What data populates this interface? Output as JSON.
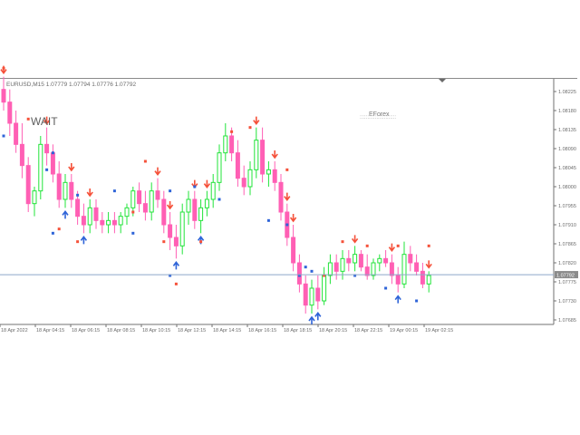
{
  "window": {
    "symbol_info": "EURUSD,M15  1.07779 1.07794 1.07776 1.07792"
  },
  "overlay": {
    "signal_text": "WAIT",
    "brand_text": "EForex",
    "brand_underline": "::::::::::::::::::::::::"
  },
  "colors": {
    "bull": "#22e43a",
    "bear": "#ff5fb4",
    "up_arrow": "#2f64d8",
    "down_arrow": "#f5513a",
    "current_price_line": "#8ea7c9",
    "price_tag_bg": "#8b8b8b",
    "axis": "#707070",
    "text": "#6b6b6b"
  },
  "chart_data": {
    "type": "candlestick",
    "timeframe": "M15",
    "symbol": "EURUSD",
    "ylim": [
      1.0766,
      1.0832
    ],
    "current_price": 1.07792,
    "current_price_label": "1.07792",
    "y_ticks": [
      "1.08225",
      "1.08180",
      "1.08135",
      "1.08090",
      "1.08045",
      "1.08000",
      "1.07955",
      "1.07910",
      "1.07865",
      "1.07820",
      "1.07775",
      "1.07730",
      "1.07685"
    ],
    "x_ticks": [
      "18 Apr 2022",
      "18 Apr 04:15",
      "18 Apr 06:15",
      "18 Apr 08:15",
      "18 Apr 10:15",
      "18 Apr 12:15",
      "18 Apr 14:15",
      "18 Apr 16:15",
      "18 Apr 18:15",
      "18 Apr 20:15",
      "18 Apr 22:15",
      "19 Apr 00:15",
      "19 Apr 02:15"
    ],
    "candles": [
      [
        1.0823,
        1.0826,
        1.0818,
        1.082
      ],
      [
        1.082,
        1.0823,
        1.0812,
        1.0815
      ],
      [
        1.0815,
        1.0818,
        1.0808,
        1.081
      ],
      [
        1.081,
        1.0815,
        1.0802,
        1.0805
      ],
      [
        1.0805,
        1.0807,
        1.0794,
        1.0796
      ],
      [
        1.0796,
        1.08,
        1.0793,
        1.0799
      ],
      [
        1.0799,
        1.0812,
        1.0797,
        1.081
      ],
      [
        1.081,
        1.0814,
        1.0805,
        1.0808
      ],
      [
        1.0808,
        1.081,
        1.0801,
        1.0803
      ],
      [
        1.0803,
        1.0806,
        1.0795,
        1.0797
      ],
      [
        1.0797,
        1.0803,
        1.0795,
        1.0801
      ],
      [
        1.0801,
        1.0803,
        1.0795,
        1.0797
      ],
      [
        1.0797,
        1.0799,
        1.0791,
        1.0793
      ],
      [
        1.0793,
        1.0796,
        1.0789,
        1.0791
      ],
      [
        1.0791,
        1.0797,
        1.0789,
        1.0795
      ],
      [
        1.0795,
        1.0797,
        1.079,
        1.0792
      ],
      [
        1.0792,
        1.0794,
        1.0789,
        1.0791
      ],
      [
        1.0791,
        1.0794,
        1.0789,
        1.0792
      ],
      [
        1.0792,
        1.0794,
        1.0789,
        1.0791
      ],
      [
        1.0791,
        1.0794,
        1.0789,
        1.0793
      ],
      [
        1.0793,
        1.0796,
        1.0791,
        1.0795
      ],
      [
        1.0795,
        1.08,
        1.0793,
        1.0799
      ],
      [
        1.0799,
        1.0801,
        1.0794,
        1.0796
      ],
      [
        1.0796,
        1.0799,
        1.0792,
        1.0794
      ],
      [
        1.0794,
        1.0801,
        1.0792,
        1.0799
      ],
      [
        1.0799,
        1.0802,
        1.0795,
        1.0797
      ],
      [
        1.0797,
        1.0799,
        1.0789,
        1.0791
      ],
      [
        1.0791,
        1.0794,
        1.0785,
        1.0788
      ],
      [
        1.0788,
        1.0791,
        1.0783,
        1.0786
      ],
      [
        1.0786,
        1.0796,
        1.0784,
        1.0794
      ],
      [
        1.0794,
        1.0799,
        1.0791,
        1.0797
      ],
      [
        1.0797,
        1.0799,
        1.079,
        1.0792
      ],
      [
        1.0792,
        1.0797,
        1.0789,
        1.0795
      ],
      [
        1.0795,
        1.0799,
        1.0793,
        1.0797
      ],
      [
        1.0797,
        1.0803,
        1.0795,
        1.0801
      ],
      [
        1.0801,
        1.081,
        1.0799,
        1.0808
      ],
      [
        1.0808,
        1.0815,
        1.0806,
        1.0812
      ],
      [
        1.0812,
        1.0814,
        1.0806,
        1.0808
      ],
      [
        1.0808,
        1.0811,
        1.08,
        1.0802
      ],
      [
        1.0802,
        1.0805,
        1.0798,
        1.08
      ],
      [
        1.08,
        1.0806,
        1.0798,
        1.0804
      ],
      [
        1.0804,
        1.0814,
        1.0802,
        1.0811
      ],
      [
        1.0811,
        1.0814,
        1.0801,
        1.0803
      ],
      [
        1.0803,
        1.0806,
        1.08,
        1.0804
      ],
      [
        1.0804,
        1.0806,
        1.0799,
        1.0801
      ],
      [
        1.0801,
        1.0803,
        1.0792,
        1.0794
      ],
      [
        1.0794,
        1.0796,
        1.0786,
        1.0788
      ],
      [
        1.0788,
        1.0791,
        1.078,
        1.0782
      ],
      [
        1.0782,
        1.0784,
        1.0775,
        1.0777
      ],
      [
        1.0777,
        1.0779,
        1.077,
        1.0772
      ],
      [
        1.0772,
        1.0778,
        1.077,
        1.0776
      ],
      [
        1.0776,
        1.0779,
        1.0771,
        1.0773
      ],
      [
        1.0773,
        1.0781,
        1.0772,
        1.0779
      ],
      [
        1.0779,
        1.0784,
        1.0777,
        1.0782
      ],
      [
        1.0782,
        1.0784,
        1.0778,
        1.078
      ],
      [
        1.078,
        1.0785,
        1.0778,
        1.0783
      ],
      [
        1.0783,
        1.0785,
        1.078,
        1.0782
      ],
      [
        1.0782,
        1.0786,
        1.078,
        1.0784
      ],
      [
        1.0784,
        1.0785,
        1.078,
        1.0781
      ],
      [
        1.0781,
        1.0784,
        1.0778,
        1.0779
      ],
      [
        1.0779,
        1.0783,
        1.0778,
        1.0782
      ],
      [
        1.0782,
        1.0784,
        1.078,
        1.0783
      ],
      [
        1.0783,
        1.0785,
        1.0781,
        1.0782
      ],
      [
        1.0782,
        1.0784,
        1.0777,
        1.0779
      ],
      [
        1.0779,
        1.0781,
        1.0775,
        1.0777
      ],
      [
        1.0777,
        1.0787,
        1.0776,
        1.0784
      ],
      [
        1.0784,
        1.0786,
        1.078,
        1.0782
      ],
      [
        1.0782,
        1.0784,
        1.0779,
        1.078
      ],
      [
        1.078,
        1.0782,
        1.0776,
        1.0777
      ],
      [
        1.0777,
        1.078,
        1.0775,
        1.0779
      ]
    ],
    "signals": [
      {
        "i": 0,
        "dir": "down"
      },
      {
        "i": 7,
        "dir": "down"
      },
      {
        "i": 10,
        "dir": "up"
      },
      {
        "i": 11,
        "dir": "down"
      },
      {
        "i": 13,
        "dir": "up"
      },
      {
        "i": 14,
        "dir": "down"
      },
      {
        "i": 25,
        "dir": "down"
      },
      {
        "i": 27,
        "dir": "down"
      },
      {
        "i": 28,
        "dir": "up"
      },
      {
        "i": 31,
        "dir": "down"
      },
      {
        "i": 32,
        "dir": "up"
      },
      {
        "i": 33,
        "dir": "down"
      },
      {
        "i": 41,
        "dir": "down"
      },
      {
        "i": 44,
        "dir": "down"
      },
      {
        "i": 46,
        "dir": "down"
      },
      {
        "i": 47,
        "dir": "down"
      },
      {
        "i": 50,
        "dir": "up"
      },
      {
        "i": 51,
        "dir": "up"
      },
      {
        "i": 57,
        "dir": "down"
      },
      {
        "i": 63,
        "dir": "down"
      },
      {
        "i": 64,
        "dir": "up"
      },
      {
        "i": 69,
        "dir": "down"
      }
    ],
    "dots": [
      {
        "i": 0,
        "v": 1.0828,
        "dir": "down"
      },
      {
        "i": 0,
        "v": 1.0812,
        "dir": "up"
      },
      {
        "i": 4,
        "v": 1.0816,
        "dir": "down"
      },
      {
        "i": 7,
        "v": 1.0804,
        "dir": "up"
      },
      {
        "i": 8,
        "v": 1.0808,
        "dir": "up"
      },
      {
        "i": 9,
        "v": 1.079,
        "dir": "down"
      },
      {
        "i": 8,
        "v": 1.0789,
        "dir": "up"
      },
      {
        "i": 12,
        "v": 1.0787,
        "dir": "down"
      },
      {
        "i": 12,
        "v": 1.0798,
        "dir": "up"
      },
      {
        "i": 18,
        "v": 1.0799,
        "dir": "up"
      },
      {
        "i": 21,
        "v": 1.0794,
        "dir": "down"
      },
      {
        "i": 21,
        "v": 1.0789,
        "dir": "up"
      },
      {
        "i": 23,
        "v": 1.0806,
        "dir": "down"
      },
      {
        "i": 26,
        "v": 1.0787,
        "dir": "down"
      },
      {
        "i": 27,
        "v": 1.0799,
        "dir": "up"
      },
      {
        "i": 27,
        "v": 1.0779,
        "dir": "up"
      },
      {
        "i": 28,
        "v": 1.0777,
        "dir": "down"
      },
      {
        "i": 31,
        "v": 1.08,
        "dir": "up"
      },
      {
        "i": 32,
        "v": 1.0787,
        "dir": "down"
      },
      {
        "i": 35,
        "v": 1.0797,
        "dir": "up"
      },
      {
        "i": 37,
        "v": 1.0813,
        "dir": "down"
      },
      {
        "i": 40,
        "v": 1.0814,
        "dir": "down"
      },
      {
        "i": 43,
        "v": 1.0792,
        "dir": "up"
      },
      {
        "i": 46,
        "v": 1.0791,
        "dir": "up"
      },
      {
        "i": 46,
        "v": 1.0804,
        "dir": "down"
      },
      {
        "i": 48,
        "v": 1.0779,
        "dir": "up"
      },
      {
        "i": 49,
        "v": 1.0781,
        "dir": "up"
      },
      {
        "i": 50,
        "v": 1.078,
        "dir": "up"
      },
      {
        "i": 52,
        "v": 1.0779,
        "dir": "down"
      },
      {
        "i": 55,
        "v": 1.0787,
        "dir": "down"
      },
      {
        "i": 57,
        "v": 1.0779,
        "dir": "up"
      },
      {
        "i": 59,
        "v": 1.0786,
        "dir": "down"
      },
      {
        "i": 62,
        "v": 1.0776,
        "dir": "up"
      },
      {
        "i": 64,
        "v": 1.0786,
        "dir": "down"
      },
      {
        "i": 67,
        "v": 1.0773,
        "dir": "up"
      },
      {
        "i": 69,
        "v": 1.0786,
        "dir": "down"
      }
    ]
  }
}
